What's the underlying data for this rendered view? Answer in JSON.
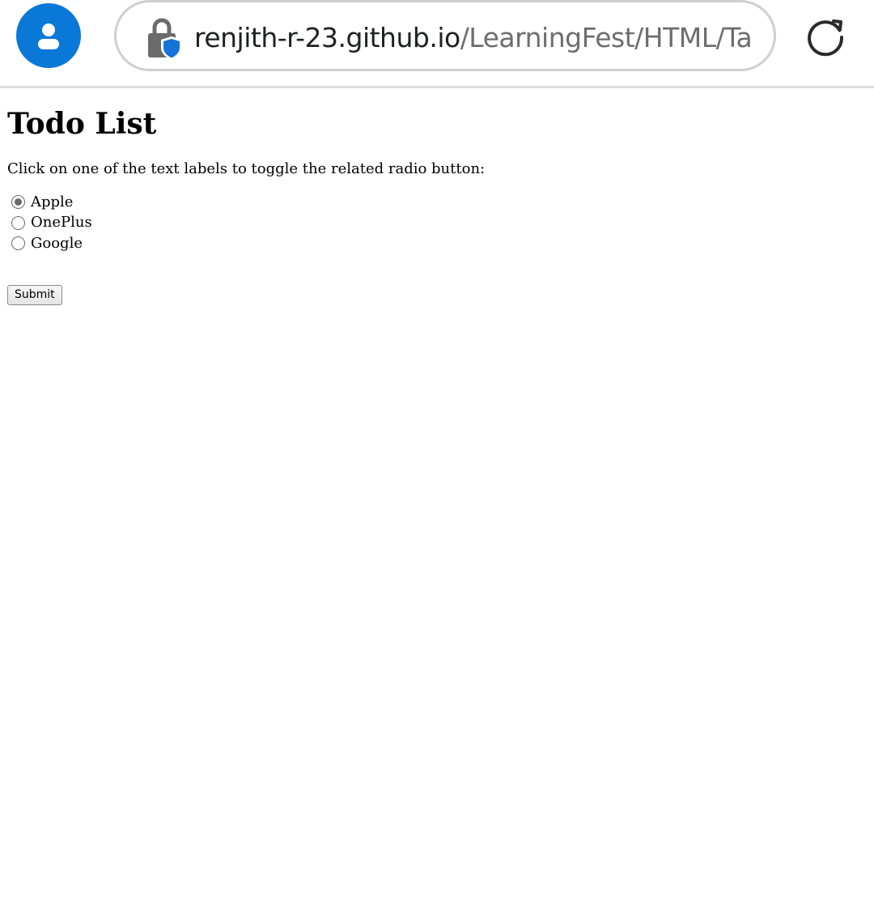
{
  "browser": {
    "url_host": "renjith-r-23.github.io",
    "url_path": "/LearningFest/HTML/Ta",
    "accent_color": "#0a78d7",
    "icons": {
      "avatar": "account-icon",
      "lock": "lock-shield-icon",
      "reload": "reload-icon"
    }
  },
  "page": {
    "title": "Todo List",
    "instructions": "Click on one of the text labels to toggle the related radio button:",
    "options": [
      {
        "label": "Apple",
        "checked": true
      },
      {
        "label": "OnePlus",
        "checked": false
      },
      {
        "label": "Google",
        "checked": false
      }
    ],
    "submit_label": "Submit"
  }
}
